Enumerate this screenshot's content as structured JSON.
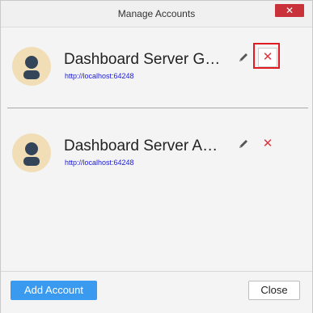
{
  "dialog": {
    "title": "Manage Accounts",
    "close_glyph": "✕"
  },
  "accounts": [
    {
      "name": "Dashboard Server Guest",
      "url": "http://localhost:64248",
      "edit_icon": "pencil-icon",
      "delete_glyph": "✕"
    },
    {
      "name": "Dashboard Server Administrator",
      "url": "http://localhost:64248",
      "edit_icon": "pencil-icon",
      "delete_glyph": "✕"
    }
  ],
  "footer": {
    "add_label": "Add Account",
    "close_label": "Close"
  },
  "colors": {
    "accent": "#3a9af0",
    "danger": "#d9363e",
    "avatar_bg": "#f2deb6",
    "avatar_fg": "#344559"
  }
}
